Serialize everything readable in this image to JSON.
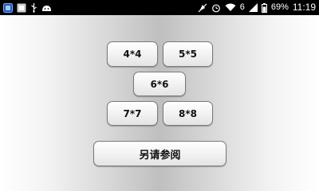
{
  "status_bar": {
    "left_icons": [
      "gallery-icon",
      "app-icon",
      "usb-icon",
      "android-debug-icon"
    ],
    "right_icons": [
      "mute-icon",
      "alarm-icon",
      "wifi-icon",
      "signal-icon",
      "battery-icon"
    ],
    "signal_label": "6",
    "battery_percent": "69%",
    "time": "11:19"
  },
  "grid_buttons": {
    "b4": "4*4",
    "b5": "5*5",
    "b6": "6*6",
    "b7": "7*7",
    "b8": "8*8"
  },
  "more_button": "另请参阅"
}
